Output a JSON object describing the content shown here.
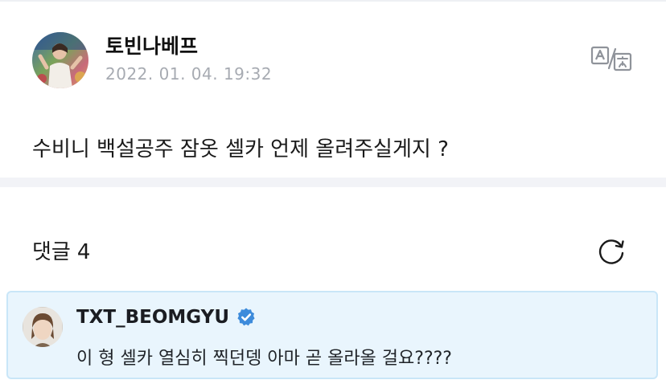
{
  "post": {
    "author": "토빈나베프",
    "timestamp": "2022. 01. 04. 19:32",
    "body": "수비니 백설공주 잠옷 셀카 언제 올려주실게지 ?",
    "translate_icon": "translate-icon"
  },
  "comments": {
    "label": "댓글",
    "count": "4",
    "refresh_icon": "refresh-icon"
  },
  "highlighted_comment": {
    "author": "TXT_BEOMGYU",
    "verified_icon": "verified-badge-icon",
    "text": "이 형 셀카 열심히 찍던뎅 아마 곧 올라올 걸요????",
    "highlight_color": "#e9f5fd",
    "verified_color": "#3d8bdb"
  }
}
